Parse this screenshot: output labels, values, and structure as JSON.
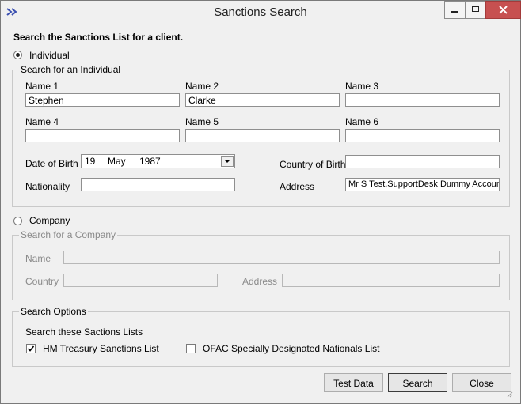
{
  "window": {
    "title": "Sanctions Search"
  },
  "header": {
    "instruction": "Search the Sanctions List for a client."
  },
  "individual": {
    "radio_label": "Individual",
    "group_title": "Search for an Individual",
    "name1_label": "Name 1",
    "name1_value": "Stephen",
    "name2_label": "Name 2",
    "name2_value": "Clarke",
    "name3_label": "Name 3",
    "name3_value": "",
    "name4_label": "Name 4",
    "name4_value": "",
    "name5_label": "Name 5",
    "name5_value": "",
    "name6_label": "Name 6",
    "name6_value": "",
    "dob_label": "Date of Birth",
    "dob_day": "19",
    "dob_month": "May",
    "dob_year": "1987",
    "country_label": "Country of Birth",
    "country_value": "",
    "nationality_label": "Nationality",
    "nationality_value": "",
    "address_label": "Address",
    "address_value": "Mr S Test,SupportDesk Dummy Account"
  },
  "company": {
    "radio_label": "Company",
    "group_title": "Search for a Company",
    "name_label": "Name",
    "country_label": "Country",
    "address_label": "Address"
  },
  "options": {
    "group_title": "Search Options",
    "lists_label": "Search these Sactions Lists",
    "hm_label": "HM Treasury Sanctions List",
    "ofac_label": "OFAC Specially Designated Nationals List"
  },
  "buttons": {
    "test_data": "Test Data",
    "search": "Search",
    "close": "Close"
  }
}
